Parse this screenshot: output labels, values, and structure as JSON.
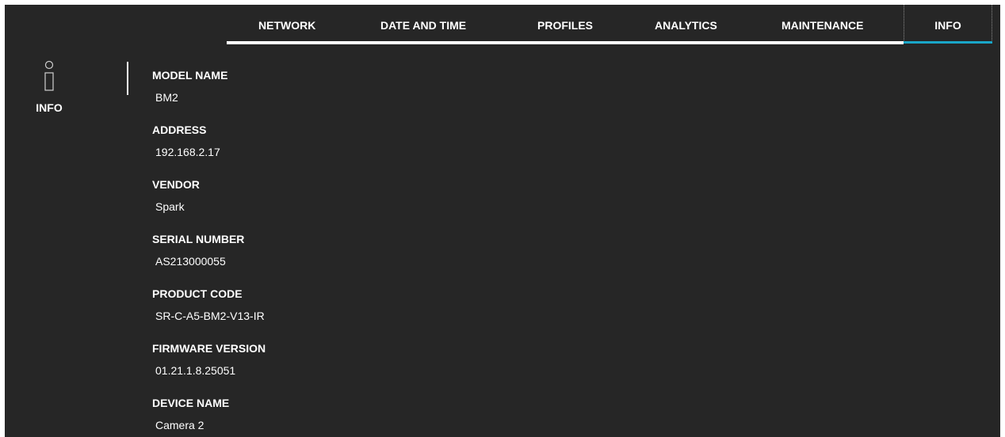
{
  "tabs": [
    {
      "label": "NETWORK"
    },
    {
      "label": "DATE AND TIME"
    },
    {
      "label": "PROFILES"
    },
    {
      "label": "ANALYTICS"
    },
    {
      "label": "MAINTENANCE"
    },
    {
      "label": "INFO",
      "selected": true
    }
  ],
  "sidebar": {
    "icon": "info-icon",
    "label": "INFO"
  },
  "fields": [
    {
      "label": "MODEL NAME",
      "value": "BM2"
    },
    {
      "label": "ADDRESS",
      "value": "192.168.2.17"
    },
    {
      "label": "VENDOR",
      "value": "Spark"
    },
    {
      "label": "SERIAL NUMBER",
      "value": "AS213000055"
    },
    {
      "label": "PRODUCT CODE",
      "value": "SR-C-A5-BM2-V13-IR"
    },
    {
      "label": "FIRMWARE VERSION",
      "value": "01.21.1.8.25051"
    },
    {
      "label": "DEVICE NAME",
      "value": "Camera 2"
    }
  ],
  "colors": {
    "background": "#262626",
    "text": "#ffffff",
    "accent": "#1aa6c8"
  }
}
